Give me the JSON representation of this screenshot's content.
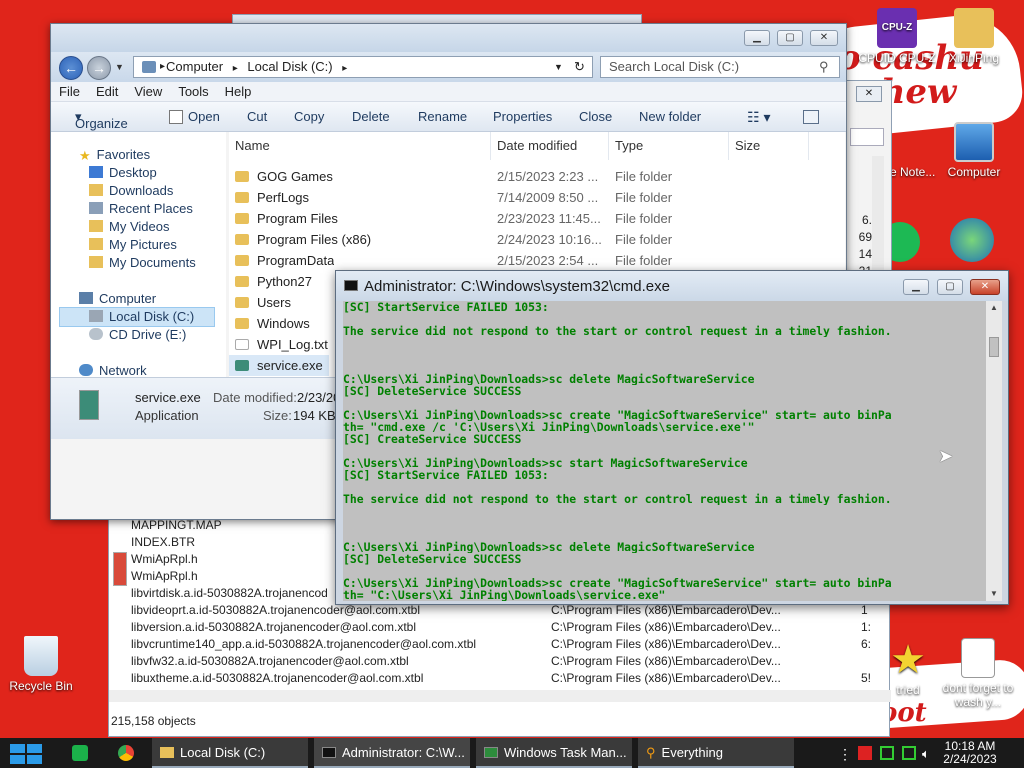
{
  "desktop": {
    "doodle_text_1": "o cashu",
    "doodle_text_2": "chew",
    "doodle_text_3": "oot",
    "icons": [
      {
        "id": "cpuz",
        "label": "CPUID CPU-Z"
      },
      {
        "id": "xi",
        "label": "XiJinPing"
      },
      {
        "id": "vmware",
        "label": "ware Note..."
      },
      {
        "id": "computer",
        "label": "Computer"
      },
      {
        "id": "recycle",
        "label": "Recycle Bin"
      },
      {
        "id": "tried",
        "label": "tried"
      },
      {
        "id": "dontforget",
        "label": "dont forget to wash y..."
      }
    ],
    "cpuz_badge": "CPU-Z"
  },
  "explorer": {
    "breadcrumb": [
      "Computer",
      "Local Disk (C:)"
    ],
    "search_placeholder": "Search Local Disk (C:)",
    "menu": [
      "File",
      "Edit",
      "View",
      "Tools",
      "Help"
    ],
    "toolbar": [
      "Organize",
      "Open",
      "Cut",
      "Copy",
      "Delete",
      "Rename",
      "Properties",
      "Close",
      "New folder"
    ],
    "nav": {
      "favorites": "Favorites",
      "fav_items": [
        "Desktop",
        "Downloads",
        "Recent Places",
        "My Videos",
        "My Pictures",
        "My Documents"
      ],
      "computer": "Computer",
      "drives": [
        "Local Disk (C:)",
        "CD Drive (E:)"
      ],
      "network": "Network"
    },
    "columns": {
      "name": "Name",
      "date": "Date modified",
      "type": "Type",
      "size": "Size"
    },
    "rows": [
      {
        "name": "GOG Games",
        "date": "2/15/2023 2:23 ...",
        "type": "File folder"
      },
      {
        "name": "PerfLogs",
        "date": "7/14/2009 8:50 ...",
        "type": "File folder"
      },
      {
        "name": "Program Files",
        "date": "2/23/2023 11:45...",
        "type": "File folder"
      },
      {
        "name": "Program Files (x86)",
        "date": "2/24/2023 10:16...",
        "type": "File folder"
      },
      {
        "name": "ProgramData",
        "date": "2/15/2023 2:54 ...",
        "type": "File folder"
      },
      {
        "name": "Python27",
        "date": "",
        "type": ""
      },
      {
        "name": "Users",
        "date": "",
        "type": ""
      },
      {
        "name": "Windows",
        "date": "",
        "type": ""
      },
      {
        "name": "WPI_Log.txt",
        "date": "",
        "type": ""
      },
      {
        "name": "service.exe",
        "date": "",
        "type": ""
      }
    ],
    "details": {
      "filename": "service.exe",
      "date_label": "Date modified:",
      "date_value": "2/23/20",
      "kind": "Application",
      "size_label": "Size:",
      "size_value": "194 KB"
    }
  },
  "bg_explorer": {
    "rows": [
      {
        "name": "MAPPINGT.MAP",
        "path": "",
        "n": ""
      },
      {
        "name": "INDEX.BTR",
        "path": "",
        "n": ""
      },
      {
        "name": "WmiApRpl.h",
        "path": "",
        "n": ""
      },
      {
        "name": "WmiApRpl.h",
        "path": "",
        "n": ""
      },
      {
        "name": "libvirtdisk.a.id-5030882A.trojanencod",
        "path": "",
        "n": ""
      },
      {
        "name": "libvideoprt.a.id-5030882A.trojanencoder@aol.com.xtbl",
        "path": "C:\\Program Files (x86)\\Embarcadero\\Dev...",
        "n": "1"
      },
      {
        "name": "libversion.a.id-5030882A.trojanencoder@aol.com.xtbl",
        "path": "C:\\Program Files (x86)\\Embarcadero\\Dev...",
        "n": "1:"
      },
      {
        "name": "libvcruntime140_app.a.id-5030882A.trojanencoder@aol.com.xtbl",
        "path": "C:\\Program Files (x86)\\Embarcadero\\Dev...",
        "n": "6:"
      },
      {
        "name": "libvfw32.a.id-5030882A.trojanencoder@aol.com.xtbl",
        "path": "C:\\Program Files (x86)\\Embarcadero\\Dev...",
        "n": ""
      },
      {
        "name": "libuxtheme.a.id-5030882A.trojanencoder@aol.com.xtbl",
        "path": "C:\\Program Files (x86)\\Embarcadero\\Dev...",
        "n": "5!"
      }
    ],
    "side_numbers": [
      "6.",
      "69",
      "14",
      "",
      "21"
    ],
    "count": "215,158 objects"
  },
  "cmd": {
    "title": "Administrator: C:\\Windows\\system32\\cmd.exe",
    "lines": [
      "[SC] StartService FAILED 1053:",
      "",
      "The service did not respond to the start or control request in a timely fashion.",
      "",
      "",
      "",
      "C:\\Users\\Xi JinPing\\Downloads>sc delete MagicSoftwareService",
      "[SC] DeleteService SUCCESS",
      "",
      "C:\\Users\\Xi JinPing\\Downloads>sc create \"MagicSoftwareService\" start= auto binPa",
      "th= \"cmd.exe /c 'C:\\Users\\Xi JinPing\\Downloads\\service.exe'\"",
      "[SC] CreateService SUCCESS",
      "",
      "C:\\Users\\Xi JinPing\\Downloads>sc start MagicSoftwareService",
      "[SC] StartService FAILED 1053:",
      "",
      "The service did not respond to the start or control request in a timely fashion.",
      "",
      "",
      "",
      "C:\\Users\\Xi JinPing\\Downloads>sc delete MagicSoftwareService",
      "[SC] DeleteService SUCCESS",
      "",
      "C:\\Users\\Xi JinPing\\Downloads>sc create \"MagicSoftwareService\" start= auto binPa",
      "th= \"C:\\Users\\Xi JinPing\\Downloads\\service.exe\""
    ]
  },
  "taskbar": {
    "items": [
      {
        "label": "Local Disk (C:)"
      },
      {
        "label": "Administrator: C:\\W..."
      },
      {
        "label": "Windows Task Man..."
      },
      {
        "label": "Everything"
      }
    ],
    "time": "10:18 AM",
    "date": "2/24/2023"
  },
  "colors": {
    "desktop": "#e0251b",
    "cmd_text": "#008000",
    "cmd_bg": "#c0c0c0",
    "taskbar": "#1a1a1a"
  }
}
